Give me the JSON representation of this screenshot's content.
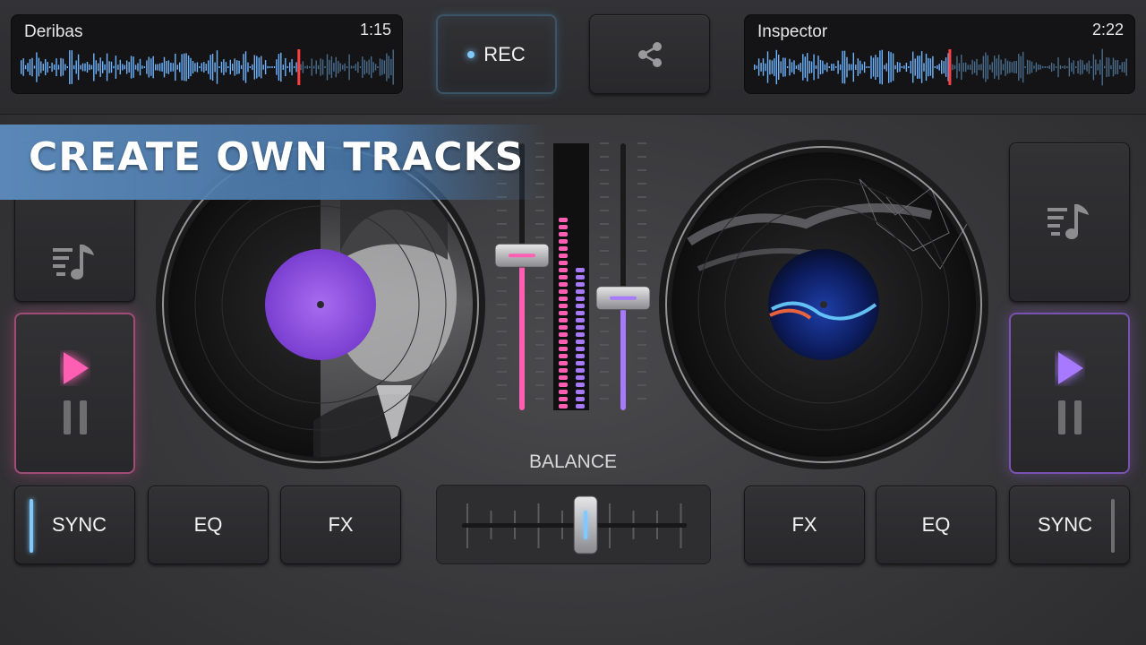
{
  "deck_left": {
    "track_name": "Deribas",
    "time": "1:15",
    "sync_label": "SYNC",
    "eq_label": "EQ",
    "fx_label": "FX",
    "accent": "#ff5fb3"
  },
  "deck_right": {
    "track_name": "Inspector",
    "time": "2:22",
    "sync_label": "SYNC",
    "eq_label": "EQ",
    "fx_label": "FX",
    "accent": "#a679ff"
  },
  "header": {
    "rec_label": "REC",
    "share_icon": "share-icon"
  },
  "banner": {
    "title": "CREATE OWN TRACKS"
  },
  "mixer": {
    "balance_label": "BALANCE",
    "balance_value": 0.55,
    "left_volume": 0.58,
    "right_volume": 0.42
  },
  "colors": {
    "wave_played": "#6fb4ff",
    "wave_unplayed": "#4a6c8c",
    "playhead": "#ff4040",
    "rec_dot": "#7fc9ff"
  }
}
